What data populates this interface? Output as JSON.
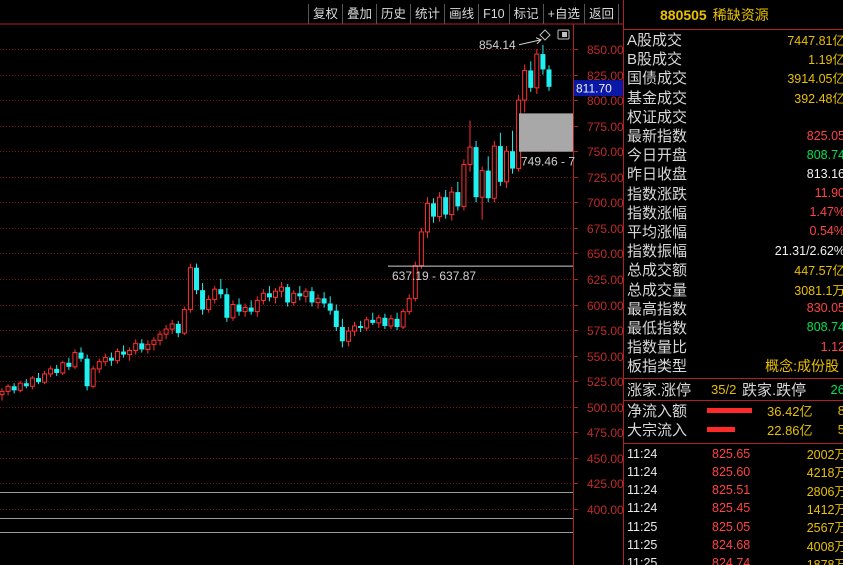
{
  "toolbar": {
    "buttons": [
      "复权",
      "叠加",
      "历史",
      "统计",
      "画线",
      "F10",
      "标记",
      "+自选",
      "返回"
    ]
  },
  "header": {
    "code": "880505",
    "name": "稀缺资源"
  },
  "stats": [
    {
      "label": "A股成交",
      "value": "7447.81亿",
      "color": "yellow"
    },
    {
      "label": "B股成交",
      "value": "1.19亿",
      "color": "yellow"
    },
    {
      "label": "国债成交",
      "value": "3914.05亿",
      "color": "yellow"
    },
    {
      "label": "基金成交",
      "value": "392.48亿",
      "color": "yellow"
    },
    {
      "label": "权证成交",
      "value": "",
      "color": "yellow"
    },
    {
      "label": "最新指数",
      "value": "825.05",
      "color": "red"
    },
    {
      "label": "今日开盘",
      "value": "808.74",
      "color": "green"
    },
    {
      "label": "昨日收盘",
      "value": "813.16",
      "color": "white"
    },
    {
      "label": "指数涨跌",
      "value": "11.90",
      "color": "red"
    },
    {
      "label": "指数涨幅",
      "value": "1.47%",
      "color": "red"
    },
    {
      "label": "平均涨幅",
      "value": "0.54%",
      "color": "red"
    },
    {
      "label": "指数振幅",
      "value": "21.31/2.62%",
      "color": "white"
    },
    {
      "label": "总成交额",
      "value": "447.57亿",
      "color": "yellow"
    },
    {
      "label": "总成交量",
      "value": "3081.1万",
      "color": "yellow"
    },
    {
      "label": "最高指数",
      "value": "830.05",
      "color": "red"
    },
    {
      "label": "最低指数",
      "value": "808.74",
      "color": "green"
    },
    {
      "label": "指数量比",
      "value": "1.12",
      "color": "red"
    },
    {
      "label": "板指类型",
      "value": "概念:成份股",
      "color": "yellow"
    }
  ],
  "breadth": {
    "up_label": "涨家.涨停",
    "up_value": "35/2",
    "down_label": "跌家.跌停",
    "down_value": "26"
  },
  "flows": [
    {
      "label": "净流入额",
      "value": "36.42亿",
      "extra": "8"
    },
    {
      "label": "大宗流入",
      "value": "22.86亿",
      "extra": "5"
    }
  ],
  "ticks": [
    {
      "time": "11:24",
      "price": "825.65",
      "vol": "2002万"
    },
    {
      "time": "11:24",
      "price": "825.60",
      "vol": "4218万"
    },
    {
      "time": "11:24",
      "price": "825.51",
      "vol": "2806万"
    },
    {
      "time": "11:24",
      "price": "825.45",
      "vol": "1412万"
    },
    {
      "time": "11:25",
      "price": "825.05",
      "vol": "2567万"
    },
    {
      "time": "11:25",
      "price": "824.68",
      "vol": "4008万"
    },
    {
      "time": "11:25",
      "price": "824.74",
      "vol": "1878万"
    }
  ],
  "chart_data": {
    "type": "candlestick",
    "y_ticks": [
      850,
      825,
      800,
      775,
      750,
      725,
      700,
      675,
      650,
      625,
      600,
      575,
      550,
      525,
      500,
      475,
      450,
      425,
      400
    ],
    "ylim": [
      393,
      865
    ],
    "current_price_label": "811.70",
    "annotations": [
      {
        "text": "854.14"
      },
      {
        "text": "749.46 - 7"
      },
      {
        "text": "637.19 - 637.87"
      }
    ],
    "candles": [
      [
        512,
        518,
        506,
        515
      ],
      [
        515,
        522,
        511,
        520
      ],
      [
        520,
        523,
        513,
        516
      ],
      [
        516,
        525,
        514,
        523
      ],
      [
        523,
        527,
        518,
        520
      ],
      [
        520,
        530,
        517,
        528
      ],
      [
        528,
        533,
        522,
        524
      ],
      [
        524,
        535,
        522,
        532
      ],
      [
        532,
        540,
        529,
        537
      ],
      [
        537,
        541,
        530,
        533
      ],
      [
        533,
        545,
        531,
        543
      ],
      [
        543,
        548,
        536,
        539
      ],
      [
        539,
        556,
        537,
        553
      ],
      [
        553,
        558,
        544,
        547
      ],
      [
        547,
        551,
        516,
        520
      ],
      [
        520,
        540,
        518,
        537
      ],
      [
        537,
        547,
        533,
        544
      ],
      [
        544,
        552,
        540,
        548
      ],
      [
        548,
        553,
        540,
        545
      ],
      [
        545,
        557,
        542,
        554
      ],
      [
        554,
        560,
        548,
        551
      ],
      [
        551,
        558,
        545,
        555
      ],
      [
        555,
        566,
        551,
        562
      ],
      [
        562,
        566,
        553,
        556
      ],
      [
        556,
        565,
        552,
        561
      ],
      [
        561,
        568,
        555,
        565
      ],
      [
        565,
        574,
        560,
        571
      ],
      [
        571,
        580,
        566,
        576
      ],
      [
        576,
        585,
        571,
        581
      ],
      [
        581,
        584,
        568,
        572
      ],
      [
        572,
        598,
        570,
        595
      ],
      [
        595,
        640,
        592,
        636
      ],
      [
        636,
        640,
        610,
        614
      ],
      [
        614,
        621,
        590,
        595
      ],
      [
        595,
        609,
        592,
        605
      ],
      [
        605,
        618,
        601,
        615
      ],
      [
        615,
        625,
        606,
        610
      ],
      [
        610,
        616,
        583,
        587
      ],
      [
        587,
        604,
        584,
        600
      ],
      [
        600,
        606,
        589,
        593
      ],
      [
        593,
        601,
        588,
        597
      ],
      [
        597,
        604,
        590,
        593
      ],
      [
        593,
        608,
        588,
        604
      ],
      [
        604,
        615,
        600,
        611
      ],
      [
        611,
        618,
        603,
        607
      ],
      [
        607,
        616,
        601,
        613
      ],
      [
        613,
        622,
        607,
        617
      ],
      [
        617,
        620,
        598,
        602
      ],
      [
        602,
        614,
        599,
        611
      ],
      [
        611,
        618,
        604,
        608
      ],
      [
        608,
        616,
        602,
        613
      ],
      [
        613,
        617,
        598,
        602
      ],
      [
        602,
        610,
        596,
        606
      ],
      [
        606,
        612,
        597,
        601
      ],
      [
        601,
        608,
        590,
        594
      ],
      [
        594,
        600,
        574,
        578
      ],
      [
        578,
        586,
        558,
        564
      ],
      [
        564,
        578,
        559,
        574
      ],
      [
        574,
        583,
        569,
        579
      ],
      [
        579,
        584,
        573,
        577
      ],
      [
        577,
        588,
        574,
        585
      ],
      [
        585,
        592,
        580,
        582
      ],
      [
        582,
        590,
        577,
        587
      ],
      [
        587,
        591,
        576,
        579
      ],
      [
        579,
        590,
        576,
        586
      ],
      [
        586,
        592,
        575,
        578
      ],
      [
        578,
        596,
        576,
        593
      ],
      [
        593,
        610,
        590,
        606
      ],
      [
        606,
        642,
        603,
        638
      ],
      [
        638,
        675,
        635,
        671
      ],
      [
        671,
        705,
        665,
        699
      ],
      [
        699,
        704,
        680,
        686
      ],
      [
        686,
        710,
        681,
        705
      ],
      [
        705,
        712,
        684,
        688
      ],
      [
        688,
        715,
        682,
        710
      ],
      [
        710,
        720,
        692,
        696
      ],
      [
        696,
        742,
        692,
        737
      ],
      [
        737,
        780,
        730,
        754
      ],
      [
        754,
        760,
        700,
        705
      ],
      [
        705,
        735,
        683,
        731
      ],
      [
        731,
        745,
        700,
        704
      ],
      [
        704,
        760,
        700,
        755
      ],
      [
        755,
        768,
        716,
        720
      ],
      [
        720,
        755,
        714,
        750
      ],
      [
        750,
        770,
        728,
        733
      ],
      [
        733,
        805,
        730,
        800
      ],
      [
        800,
        835,
        788,
        829
      ],
      [
        829,
        838,
        808,
        812
      ],
      [
        812,
        850,
        806,
        845
      ],
      [
        845,
        854,
        825,
        830
      ],
      [
        830,
        834,
        809,
        813
      ]
    ]
  }
}
